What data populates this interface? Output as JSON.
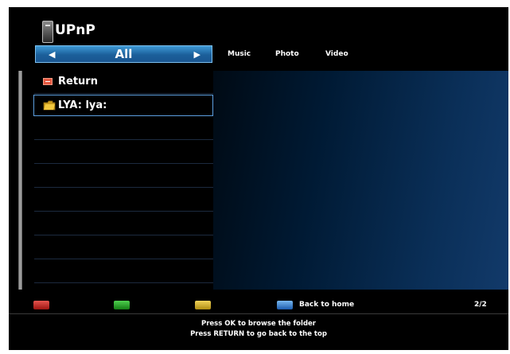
{
  "header": {
    "title": "UPnP",
    "icon": "media-device-icon"
  },
  "category": {
    "selected": "All",
    "left_arrow": "◀",
    "right_arrow": "▶"
  },
  "tabs": [
    "Music",
    "Photo",
    "Video"
  ],
  "list": [
    {
      "label": "Return",
      "icon": "return-icon"
    },
    {
      "label": "LYA: lya:",
      "icon": "folder-icon"
    }
  ],
  "footer": {
    "blue_label": "Back to home",
    "page": "2/2"
  },
  "help": {
    "line1": "Press OK to browse the folder",
    "line2": "Press RETURN to go back to the top"
  },
  "colors": {
    "accent": "#1b5f9a",
    "selection_border": "#5c9fe0",
    "red": "#c0201c",
    "green": "#2aa52a",
    "yellow": "#d6b22e",
    "blue": "#3b84d4"
  }
}
